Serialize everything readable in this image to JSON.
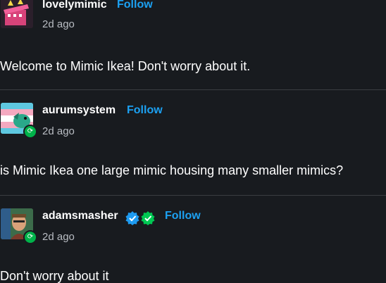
{
  "posts": [
    {
      "username": "lovelymimic",
      "follow_label": "Follow",
      "timestamp": "2d ago",
      "body": "Welcome to Mimic Ikea! Don't worry about it.",
      "avatar": {
        "icon": "mimic-box-avatar",
        "bg": "#3a2a3a"
      },
      "reblog": false
    },
    {
      "username": "aurumsystem",
      "follow_label": "Follow",
      "timestamp": "2d ago",
      "body": "is Mimic Ikea one large mimic housing many smaller mimics?",
      "avatar": {
        "icon": "dragon-flag-avatar",
        "bg": "#5ec8e0"
      },
      "reblog": true
    },
    {
      "username": "adamsmasher",
      "follow_label": "Follow",
      "timestamp": "2d ago",
      "body": "Don't worry about it",
      "avatar": {
        "icon": "person-photo-avatar",
        "bg": "#4a8a5a"
      },
      "reblog": true,
      "badges": [
        "blue-verified-badge-icon",
        "green-verified-badge-icon"
      ]
    }
  ],
  "colors": {
    "background": "#181b1f",
    "link": "#1ca1f2",
    "muted": "#b8bcc2",
    "divider": "#3a3d42",
    "reblog_green": "#00b34a",
    "verified_blue": "#1e9bf0",
    "verified_green": "#00c853"
  }
}
